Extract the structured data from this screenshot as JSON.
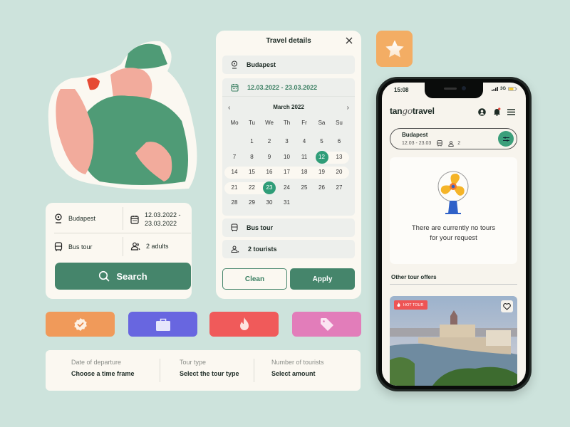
{
  "colors": {
    "background": "#cde3dc",
    "card": "#fbf8f1",
    "primary": "#45856b",
    "accent_green": "#2f9d78",
    "orange": "#f09a5a",
    "indigo": "#6866e0",
    "red": "#f05a5a",
    "pink": "#e27dba",
    "star_tile": "#f3ad64"
  },
  "search_card": {
    "location": "Budapest",
    "dates_line1": "12.03.2022 -",
    "dates_line2": "23.03.2022",
    "tour_type": "Bus tour",
    "guests": "2 adults",
    "search_label": "Search"
  },
  "modal": {
    "title": "Travel details",
    "close_icon": "close-icon",
    "location": "Budapest",
    "date_range": "12.03.2022 - 23.03.2022",
    "calendar": {
      "month_label": "March 2022",
      "weekdays": [
        "Mo",
        "Tu",
        "We",
        "Th",
        "Fr",
        "Sa",
        "Su"
      ],
      "first_weekday_index": 1,
      "days_in_month": 31,
      "range_start": 12,
      "range_end": 23
    },
    "tour_type": "Bus tour",
    "tourists": "2 tourists",
    "clean_label": "Clean",
    "apply_label": "Apply"
  },
  "icon_tiles": [
    {
      "name": "verified-badge-icon",
      "color": "#f09a5a"
    },
    {
      "name": "briefcase-icon",
      "color": "#6866e0"
    },
    {
      "name": "fire-icon",
      "color": "#f05a5a"
    },
    {
      "name": "tag-icon",
      "color": "#e27dba"
    }
  ],
  "filter_bar": {
    "columns": [
      {
        "label": "Date of departure",
        "value": "Choose a time frame"
      },
      {
        "label": "Tour type",
        "value": "Select the tour type"
      },
      {
        "label": "Number of tourists",
        "value": "Select amount"
      }
    ]
  },
  "phone": {
    "time": "15:08",
    "network": "3G",
    "logo_prefix": "tan",
    "logo_go": "go",
    "logo_suffix": "travel",
    "pill": {
      "city": "Budapest",
      "dates": "12.03 - 23.03",
      "guests": "2"
    },
    "empty_message_line1": "There are currently no tours",
    "empty_message_line2": "for your request",
    "other_offers_title": "Other tour offers",
    "hot_badge": "HOT TOUR"
  }
}
